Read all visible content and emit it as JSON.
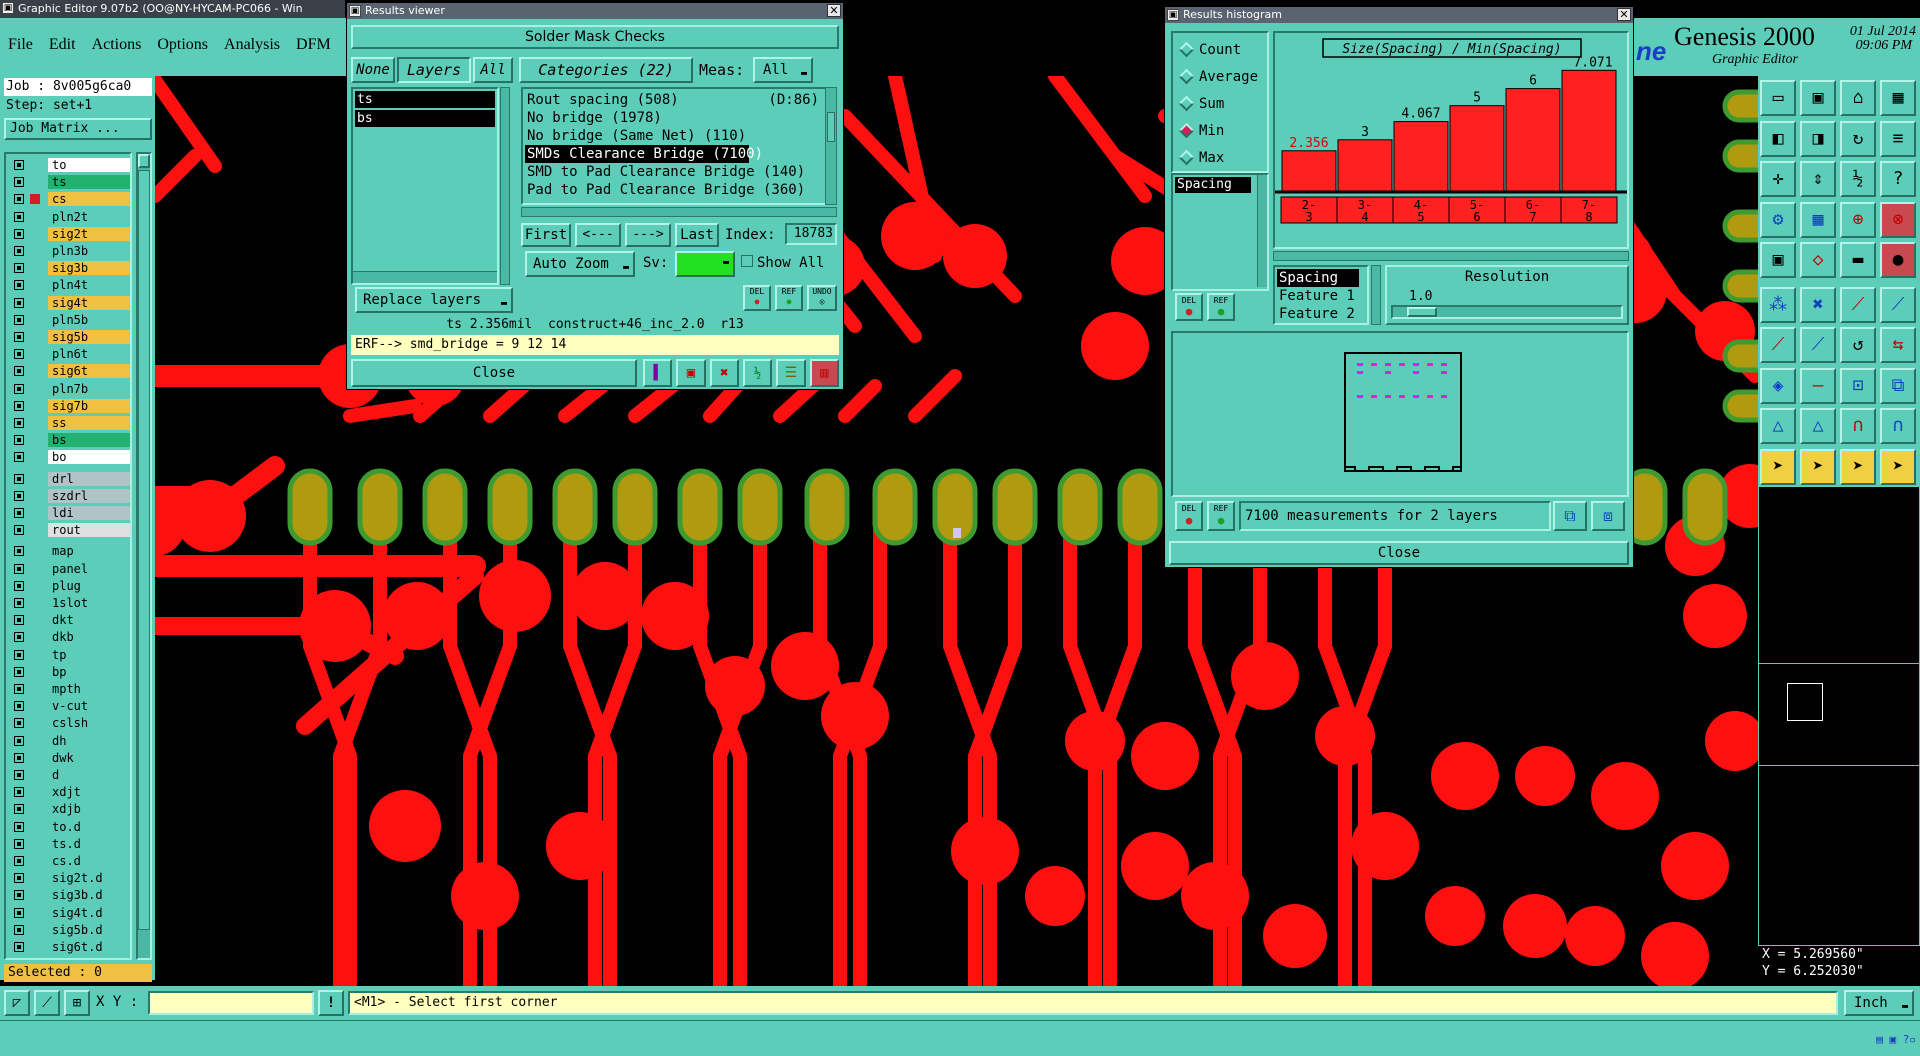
{
  "app": {
    "title": "Graphic Editor 9.07b2 (OO@NY-HYCAM-PC066 - Win",
    "menu": [
      "File",
      "Edit",
      "Actions",
      "Options",
      "Analysis",
      "DFM"
    ],
    "brand_title": "Genesis 2000",
    "brand_sub": "Graphic Editor",
    "brand_partial": "ne",
    "date": "01 Jul 2014",
    "time": "09:06 PM"
  },
  "job": {
    "job_label": "Job : 8v005g6ca0",
    "step_label": "Step: set+1",
    "matrix_button": "Job Matrix ...",
    "selected": "Selected : 0"
  },
  "layers": [
    {
      "name": "to",
      "color": "#ffffff"
    },
    {
      "name": "ts",
      "color": "#21b26f"
    },
    {
      "name": "cs",
      "color": "#f0c040"
    },
    {
      "name": "pln2t",
      "color": "#5ccdb8"
    },
    {
      "name": "sig2t",
      "color": "#f0c040"
    },
    {
      "name": "pln3b",
      "color": "#5ccdb8"
    },
    {
      "name": "sig3b",
      "color": "#f0c040"
    },
    {
      "name": "pln4t",
      "color": "#5ccdb8"
    },
    {
      "name": "sig4t",
      "color": "#f0c040"
    },
    {
      "name": "pln5b",
      "color": "#5ccdb8"
    },
    {
      "name": "sig5b",
      "color": "#f0c040"
    },
    {
      "name": "pln6t",
      "color": "#5ccdb8"
    },
    {
      "name": "sig6t",
      "color": "#f0c040"
    },
    {
      "name": "pln7b",
      "color": "#5ccdb8"
    },
    {
      "name": "sig7b",
      "color": "#f0c040"
    },
    {
      "name": "ss",
      "color": "#f0c040"
    },
    {
      "name": "bs",
      "color": "#21b26f"
    },
    {
      "name": "bo",
      "color": "#ffffff"
    },
    {
      "name": "drl",
      "color": "#b0c4c8"
    },
    {
      "name": "szdrl",
      "color": "#b0c4c8"
    },
    {
      "name": "ldi",
      "color": "#b0c4c8"
    },
    {
      "name": "rout",
      "color": "#e0e0e0"
    },
    {
      "name": "map",
      "color": "#5ccdb8"
    },
    {
      "name": "panel",
      "color": "#5ccdb8"
    },
    {
      "name": "plug",
      "color": "#5ccdb8"
    },
    {
      "name": "1slot",
      "color": "#5ccdb8"
    },
    {
      "name": "dkt",
      "color": "#5ccdb8"
    },
    {
      "name": "dkb",
      "color": "#5ccdb8"
    },
    {
      "name": "tp",
      "color": "#5ccdb8"
    },
    {
      "name": "bp",
      "color": "#5ccdb8"
    },
    {
      "name": "mpth",
      "color": "#5ccdb8"
    },
    {
      "name": "v-cut",
      "color": "#5ccdb8"
    },
    {
      "name": "cslsh",
      "color": "#5ccdb8"
    },
    {
      "name": "dh",
      "color": "#5ccdb8"
    },
    {
      "name": "dwk",
      "color": "#5ccdb8"
    },
    {
      "name": "d",
      "color": "#5ccdb8"
    },
    {
      "name": "xdjt",
      "color": "#5ccdb8"
    },
    {
      "name": "xdjb",
      "color": "#5ccdb8"
    },
    {
      "name": "to.d",
      "color": "#5ccdb8"
    },
    {
      "name": "ts.d",
      "color": "#5ccdb8"
    },
    {
      "name": "cs.d",
      "color": "#5ccdb8"
    },
    {
      "name": "sig2t.d",
      "color": "#5ccdb8"
    },
    {
      "name": "sig3b.d",
      "color": "#5ccdb8"
    },
    {
      "name": "sig4t.d",
      "color": "#5ccdb8"
    },
    {
      "name": "sig5b.d",
      "color": "#5ccdb8"
    },
    {
      "name": "sig6t.d",
      "color": "#5ccdb8"
    }
  ],
  "results_viewer": {
    "title": "Results viewer",
    "header": "Solder Mask Checks",
    "none_btn": "None",
    "layers_btn": "Layers",
    "all_btn": "All",
    "categories_btn": "Categories (22)",
    "meas_label": "Meas:",
    "meas_value": "All",
    "layer_list": [
      "ts",
      "bs"
    ],
    "categories": [
      {
        "label": "Rout spacing (508)",
        "extra": "(D:86)"
      },
      {
        "label": "No bridge (1978)",
        "extra": ""
      },
      {
        "label": "No bridge (Same Net) (110)",
        "extra": ""
      },
      {
        "label": "SMDs Clearance Bridge (7100)",
        "extra": ""
      },
      {
        "label": "SMD to Pad Clearance Bridge (140)",
        "extra": ""
      },
      {
        "label": "Pad to Pad Clearance Bridge (360)",
        "extra": ""
      }
    ],
    "first_btn": "First",
    "prev_btn": "<---",
    "next_btn": "--->",
    "last_btn": "Last",
    "index_label": "Index:",
    "index_value": "18783",
    "auto_zoom": "Auto Zoom",
    "sv_label": "Sv:",
    "show_all": "Show All",
    "replace_layers": "Replace layers",
    "del": "DEL",
    "ref": "REF",
    "undo": "UNDO",
    "status_line": "ts 2.356mil  construct+46_inc_2.0  r13",
    "erf_line": "ERF--> smd_bridge = 9 12 14",
    "close": "Close"
  },
  "histogram": {
    "title": "Results histogram",
    "modes": [
      "Count",
      "Average",
      "Sum",
      "Min",
      "Max"
    ],
    "selected_mode": "Min",
    "list_item": "Spacing",
    "plot_title": "Size(Spacing) / Min(Spacing)",
    "bar_color": "#ff2020",
    "del": "DEL",
    "ref": "REF",
    "fields": [
      "Spacing",
      "Feature 1",
      "Feature 2"
    ],
    "resolution_label": "Resolution",
    "resolution_value": "1.0",
    "measurements": "7100 measurements for 2 layers",
    "close": "Close"
  },
  "chart_data": {
    "type": "bar",
    "title": "Size(Spacing) / Min(Spacing)",
    "categories": [
      "2-3",
      "3-4",
      "4-5",
      "5-6",
      "6-7",
      "7-8"
    ],
    "values": [
      2.356,
      3,
      4.067,
      5,
      6,
      7.071
    ],
    "value_labels": [
      "2.356",
      "3",
      "4.067",
      "5",
      "6",
      "7.071"
    ],
    "ylim": [
      0,
      7.5
    ]
  },
  "status": {
    "xy_label": "X Y :",
    "xy_value": "",
    "prompt": "<M1> - Select first corner",
    "units": "Inch",
    "x_coord": "X = 5.269560\"",
    "y_coord": "Y = 6.252030\""
  },
  "colors": {
    "panel": "#5ccdb8",
    "copper": "#ff1010",
    "pad": "#b09a10",
    "pad_ring": "#3f9a30"
  }
}
